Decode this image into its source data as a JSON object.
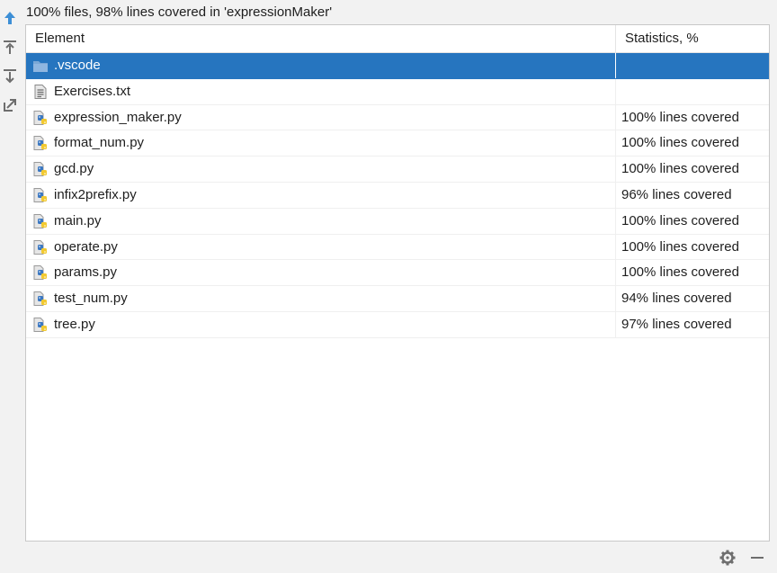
{
  "header": {
    "title": "100% files, 98% lines covered in 'expressionMaker'"
  },
  "toolbar": {
    "buttons": [
      {
        "name": "go-up-icon",
        "color": "#3d8fd6"
      },
      {
        "name": "import-icon",
        "color": "#6e6e6e"
      },
      {
        "name": "export-icon",
        "color": "#6e6e6e"
      },
      {
        "name": "open-external-icon",
        "color": "#6e6e6e"
      }
    ]
  },
  "table": {
    "columns": [
      "Element",
      "Statistics, %"
    ],
    "rows": [
      {
        "name": ".vscode",
        "stat": "",
        "icon": "folder-icon",
        "selected": true
      },
      {
        "name": "Exercises.txt",
        "stat": "",
        "icon": "text-file-icon"
      },
      {
        "name": "expression_maker.py",
        "stat": "100% lines covered",
        "icon": "python-file-icon"
      },
      {
        "name": "format_num.py",
        "stat": "100% lines covered",
        "icon": "python-file-icon"
      },
      {
        "name": "gcd.py",
        "stat": "100% lines covered",
        "icon": "python-file-icon"
      },
      {
        "name": "infix2prefix.py",
        "stat": "96% lines covered",
        "icon": "python-file-icon"
      },
      {
        "name": "main.py",
        "stat": "100% lines covered",
        "icon": "python-file-icon"
      },
      {
        "name": "operate.py",
        "stat": "100% lines covered",
        "icon": "python-file-icon"
      },
      {
        "name": "params.py",
        "stat": "100% lines covered",
        "icon": "python-file-icon"
      },
      {
        "name": "test_num.py",
        "stat": "94% lines covered",
        "icon": "python-file-icon"
      },
      {
        "name": "tree.py",
        "stat": "97% lines covered",
        "icon": "python-file-icon"
      }
    ]
  },
  "bottom": {
    "icons": [
      "gear-icon",
      "minimize-icon"
    ]
  },
  "colors": {
    "selection": "#2675bf",
    "accent": "#3d8fd6"
  }
}
